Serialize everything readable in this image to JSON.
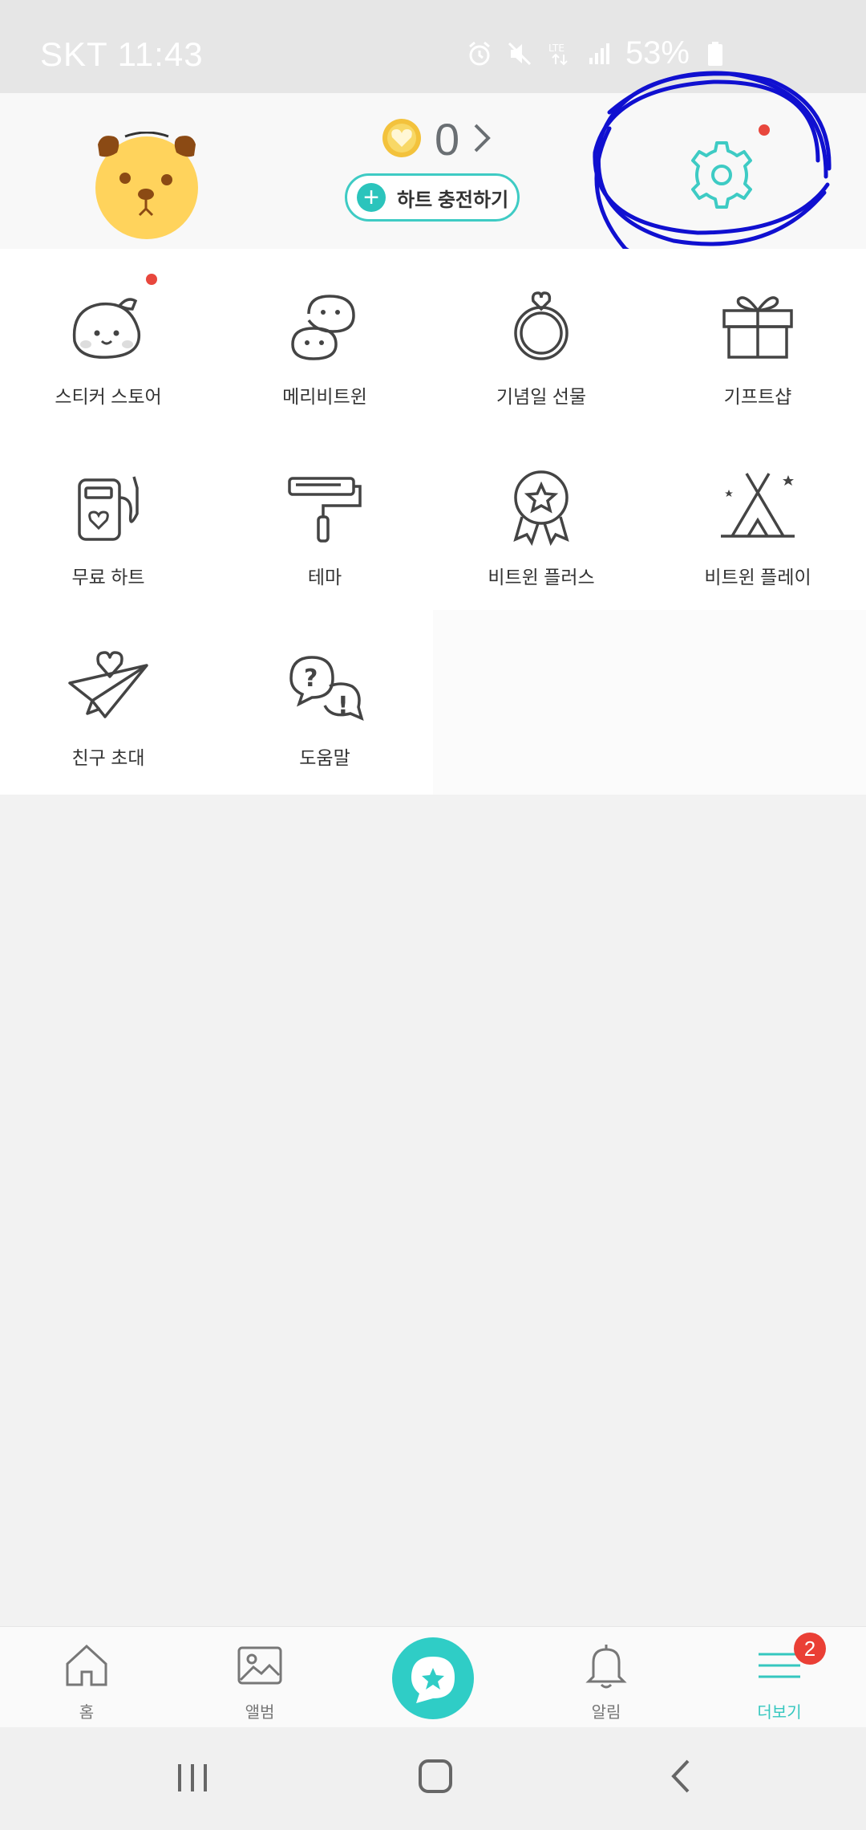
{
  "status_bar": {
    "carrier": "SKT",
    "time": "11:43",
    "network": "LTE",
    "battery": "53%",
    "icons": [
      "alarm-icon",
      "mute-icon",
      "lte-icon",
      "signal-icon",
      "battery-icon"
    ]
  },
  "header": {
    "heart_count": "0",
    "charge_button_label": "하트 충전하기",
    "settings_has_notification": true
  },
  "menu": {
    "items": [
      {
        "label": "스티커 스토어",
        "icon": "sticker-seal-icon",
        "badge": true
      },
      {
        "label": "메리비트윈",
        "icon": "mery-chat-icon",
        "badge": false
      },
      {
        "label": "기념일 선물",
        "icon": "ring-icon",
        "badge": false
      },
      {
        "label": "기프트샵",
        "icon": "gift-icon",
        "badge": false
      },
      {
        "label": "무료 하트",
        "icon": "heart-pump-icon",
        "badge": false
      },
      {
        "label": "테마",
        "icon": "paint-roller-icon",
        "badge": false
      },
      {
        "label": "비트윈 플러스",
        "icon": "badge-star-icon",
        "badge": false
      },
      {
        "label": "비트윈 플레이",
        "icon": "tent-icon",
        "badge": false
      },
      {
        "label": "친구 초대",
        "icon": "paper-plane-heart-icon",
        "badge": false
      },
      {
        "label": "도움말",
        "icon": "help-bubbles-icon",
        "badge": false
      }
    ]
  },
  "bottom_nav": {
    "items": [
      {
        "label": "홈",
        "icon": "home-icon"
      },
      {
        "label": "앨범",
        "icon": "album-icon"
      },
      {
        "label": "",
        "icon": "chat-star-icon"
      },
      {
        "label": "알림",
        "icon": "bell-icon"
      },
      {
        "label": "더보기",
        "icon": "menu-icon",
        "active": true
      }
    ],
    "more_badge": "2"
  },
  "colors": {
    "accent": "#2fcdc6",
    "notification": "#e8473d",
    "annotation": "#1010d0"
  }
}
